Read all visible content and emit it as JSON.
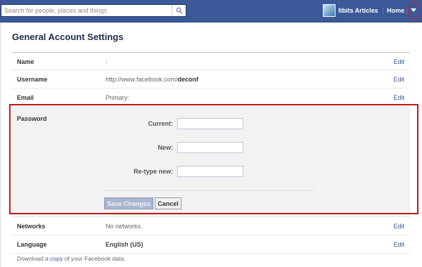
{
  "topbar": {
    "search_placeholder": "Search for people, places and things",
    "search_icon": "magnifier-icon",
    "profile_name": "Itbits Articles",
    "home_label": "Home",
    "account_menu_icon": "caret-down-icon",
    "brand_color": "#3b5998"
  },
  "page": {
    "title": "General Account Settings"
  },
  "rows": {
    "name": {
      "label": "Name",
      "value": ":",
      "edit": "Edit"
    },
    "username": {
      "label": "Username",
      "value_prefix": "http://www.facebook.com/",
      "value_bold": "deconf",
      "edit": "Edit"
    },
    "email": {
      "label": "Email",
      "value": "Primary:",
      "edit": "Edit"
    },
    "networks": {
      "label": "Networks",
      "value": "No networks.",
      "edit": "Edit"
    },
    "language": {
      "label": "Language",
      "value": "English (US)",
      "edit": "Edit"
    }
  },
  "password": {
    "label": "Password",
    "current_label": "Current:",
    "current_value": "",
    "new_label": "New:",
    "new_value": "",
    "retype_label": "Re-type new:",
    "retype_value": "",
    "save_label": "Save Changes",
    "cancel_label": "Cancel"
  },
  "footer": {
    "prefix": "Download a",
    "link": "copy",
    "suffix": "of your Facebook data."
  },
  "highlight_color": "#c4161c"
}
